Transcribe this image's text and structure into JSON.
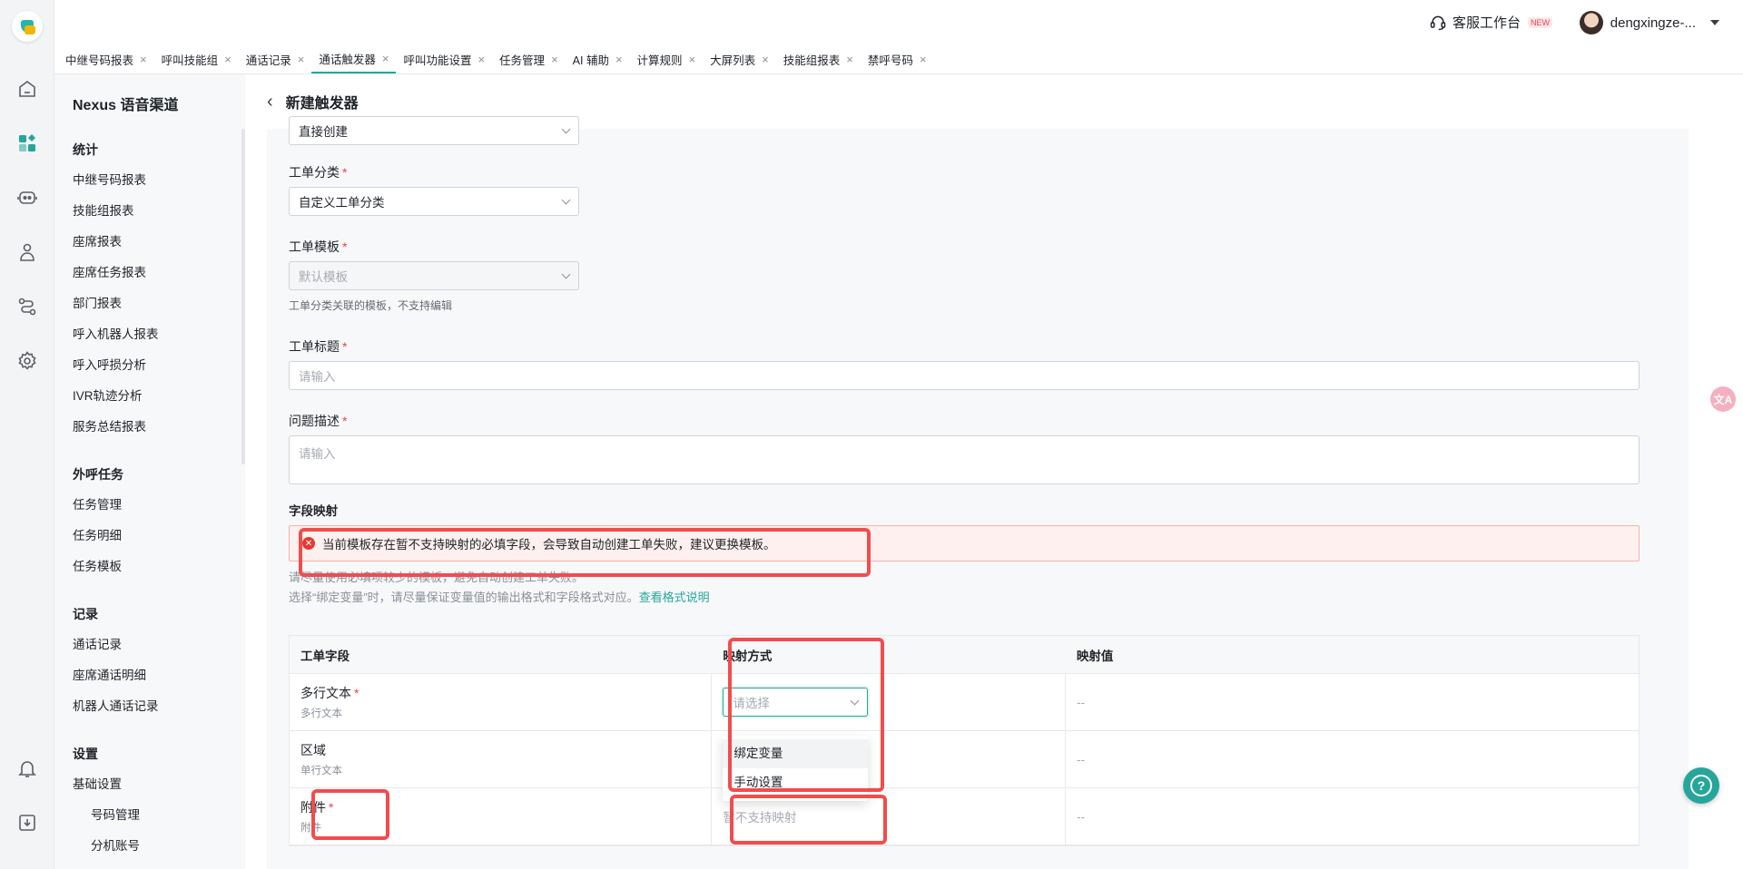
{
  "header": {
    "workspace_label": "客服工作台",
    "new_badge": "NEW",
    "username": "dengxingze-..."
  },
  "tabs": [
    {
      "label": "中继号码报表"
    },
    {
      "label": "呼叫技能组"
    },
    {
      "label": "通话记录"
    },
    {
      "label": "通话触发器",
      "active": true
    },
    {
      "label": "呼叫功能设置"
    },
    {
      "label": "任务管理"
    },
    {
      "label": "AI 辅助"
    },
    {
      "label": "计算规则"
    },
    {
      "label": "大屏列表"
    },
    {
      "label": "技能组报表"
    },
    {
      "label": "禁呼号码"
    }
  ],
  "sidebar": {
    "title": "Nexus 语音渠道",
    "groups": [
      {
        "label": "统计",
        "items": [
          "中继号码报表",
          "技能组报表",
          "座席报表",
          "座席任务报表",
          "部门报表",
          "呼入机器人报表",
          "呼入呼损分析",
          "IVR轨迹分析",
          "服务总结报表"
        ]
      },
      {
        "label": "外呼任务",
        "items": [
          "任务管理",
          "任务明细",
          "任务模板"
        ]
      },
      {
        "label": "记录",
        "items": [
          "通话记录",
          "座席通话明细",
          "机器人通话记录"
        ]
      },
      {
        "label": "设置",
        "items": [
          "基础设置"
        ],
        "sub_items": [
          "号码管理",
          "分机账号"
        ]
      }
    ]
  },
  "page": {
    "back_icon": "chevron-left-icon",
    "title": "新建触发器"
  },
  "form": {
    "create_mode_value": "直接创建",
    "ticket_category_label": "工单分类",
    "ticket_category_value": "自定义工单分类",
    "ticket_template_label": "工单模板",
    "ticket_template_value": "默认模板",
    "ticket_template_hint": "工单分类关联的模板，不支持编辑",
    "ticket_title_label": "工单标题",
    "ticket_title_placeholder": "请输入",
    "problem_desc_label": "问题描述",
    "problem_desc_placeholder": "请输入",
    "required_mark": "*"
  },
  "mapping": {
    "section_title": "字段映射",
    "alert_text": "当前模板存在暂不支持映射的必填字段，会导致自动创建工单失败，建议更换模板。",
    "note_line1": "请尽量使用必填项较少的模板，避免自动创建工单失败。",
    "note_line2": "选择“绑定变量”时，请尽量保证变量值的输出格式和字段格式对应。",
    "note_link": "查看格式说明",
    "columns": [
      "工单字段",
      "映射方式",
      "映射值"
    ],
    "rows": [
      {
        "field": "多行文本",
        "type": "多行文本",
        "required": true,
        "mode_placeholder": "请选择",
        "value": "--"
      },
      {
        "field": "区域",
        "type": "单行文本",
        "required": false,
        "value": "--"
      },
      {
        "field": "附件",
        "type": "附件",
        "required": true,
        "mode_text": "暂不支持映射",
        "value": "--"
      }
    ],
    "dropdown_options": [
      "绑定变量",
      "手动设置"
    ]
  },
  "floats": {
    "help": "?",
    "translate": "文A"
  },
  "colors": {
    "accent": "#26a69a",
    "error": "#f0414b",
    "highlight": "#f24c4c"
  }
}
